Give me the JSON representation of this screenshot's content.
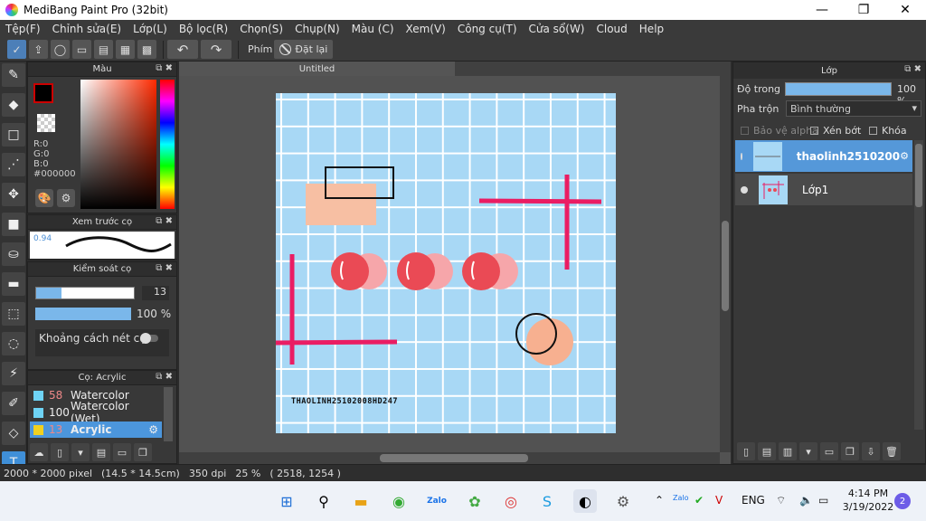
{
  "window": {
    "title": "MediBang Paint Pro (32bit)",
    "min": "—",
    "max": "❐",
    "close": "✕"
  },
  "menu": [
    "Tệp(F)",
    "Chỉnh sửa(E)",
    "Lớp(L)",
    "Bộ lọc(R)",
    "Chọn(S)",
    "Chụp(N)",
    "Màu (C)",
    "Xem(V)",
    "Công cụ(T)",
    "Cửa sổ(W)",
    "Cloud",
    "Help"
  ],
  "toolbar": {
    "shortcut_label": "Phím",
    "reset_label": "Đặt lại"
  },
  "color_panel": {
    "title": "Màu",
    "r": "R:0",
    "g": "G:0",
    "b": "B:0",
    "hex": "#000000",
    "fg_color": "#000000"
  },
  "preview_panel": {
    "title": "Xem trước cọ",
    "size_value": "0.94"
  },
  "brush_control": {
    "title": "Kiểm soát cọ",
    "size": "13",
    "opacity": "100 %",
    "opacity_fraction": 1.0,
    "spacing_label": "Khoảng cách nét cọ"
  },
  "brush_list": {
    "title": "Cọ: Acrylic",
    "items": [
      {
        "num": "58",
        "name": "Watercolor",
        "color": "#6ed3f5"
      },
      {
        "num": "100",
        "name": "Watercolor (Wet)",
        "color": "#6ed3f5"
      },
      {
        "num": "13",
        "name": "Acrylic",
        "color": "#f0d020"
      }
    ]
  },
  "canvas": {
    "tab_title": "Untitled",
    "watermark": "THAOLINH25102008HD247"
  },
  "status": {
    "size": "2000 * 2000 pixel",
    "cm": "(14.5 * 14.5cm)",
    "dpi": "350 dpi",
    "zoom": "25 %",
    "coords": "( 2518, 1254 )"
  },
  "layer_panel": {
    "title": "Lớp",
    "opacity_label": "Độ trong",
    "opacity_value": "100 %",
    "blend_label": "Pha trộn",
    "blend_value": "Bình thường",
    "protect_alpha": "Bảo vệ alpha",
    "clip": "Xén bớt",
    "lock": "Khóa",
    "layers": [
      {
        "name": "thaolinh2510200"
      },
      {
        "name": "Lớp1"
      }
    ]
  },
  "taskbar": {
    "lang": "ENG",
    "time": "4:14 PM",
    "date": "3/19/2022",
    "notifications": "2",
    "zalo": "Zalo"
  }
}
